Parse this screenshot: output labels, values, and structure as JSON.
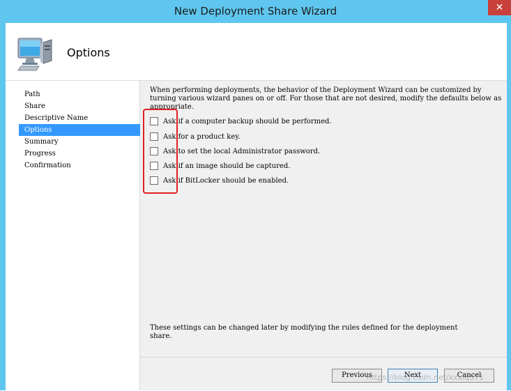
{
  "window": {
    "title": "New Deployment Share Wizard",
    "close_glyph": "✕"
  },
  "header": {
    "icon": "computer-icon",
    "title": "Options"
  },
  "nav": {
    "items": [
      {
        "label": "Path"
      },
      {
        "label": "Share"
      },
      {
        "label": "Descriptive Name"
      },
      {
        "label": "Options"
      },
      {
        "label": "Summary"
      },
      {
        "label": "Progress"
      },
      {
        "label": "Confirmation"
      }
    ],
    "selected": "Options",
    "selected_color": "#3399ff"
  },
  "content": {
    "intro": "When performing deployments, the behavior of the Deployment Wizard can be customized by turning various wizard panes on or off.  For those that are not desired, modify the defaults below as appropriate.",
    "options": [
      {
        "label": "Ask if a computer backup should be performed.",
        "checked": false
      },
      {
        "label": "Ask for a product key.",
        "checked": false
      },
      {
        "label": "Ask to set the local Administrator password.",
        "checked": false
      },
      {
        "label": "Ask if an image should be captured.",
        "checked": false
      },
      {
        "label": "Ask if BitLocker should be enabled.",
        "checked": false
      }
    ],
    "footer_note": "These settings can be changed later by modifying the rules defined for the deployment share."
  },
  "buttons": {
    "previous": "Previous",
    "next": "Next",
    "cancel": "Cancel"
  },
  "watermark": "https://blog.csdn.net/xxxlq371",
  "colors": {
    "titlebar": "#5fc7ef",
    "close": "#c9403b",
    "annotation": "#e02020"
  }
}
